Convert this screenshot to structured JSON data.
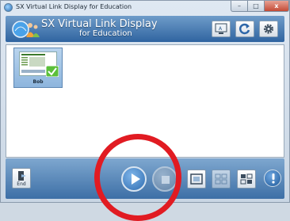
{
  "window": {
    "title": "SX Virtual Link Display for Education"
  },
  "header": {
    "app_name": "SX Virtual Link Display",
    "app_subtitle": "for Education"
  },
  "devices": [
    {
      "name": "Bob"
    }
  ],
  "footer": {
    "end_label": "End"
  },
  "colors": {
    "accent": "#2f64a0",
    "annotation": "#e11b22"
  },
  "icons": [
    "app-logo-icon",
    "display-icon",
    "refresh-icon",
    "gear-icon",
    "end-icon",
    "play-icon",
    "stop-icon",
    "fullscreen-icon",
    "grid-icon",
    "layout-icon",
    "info-icon"
  ]
}
